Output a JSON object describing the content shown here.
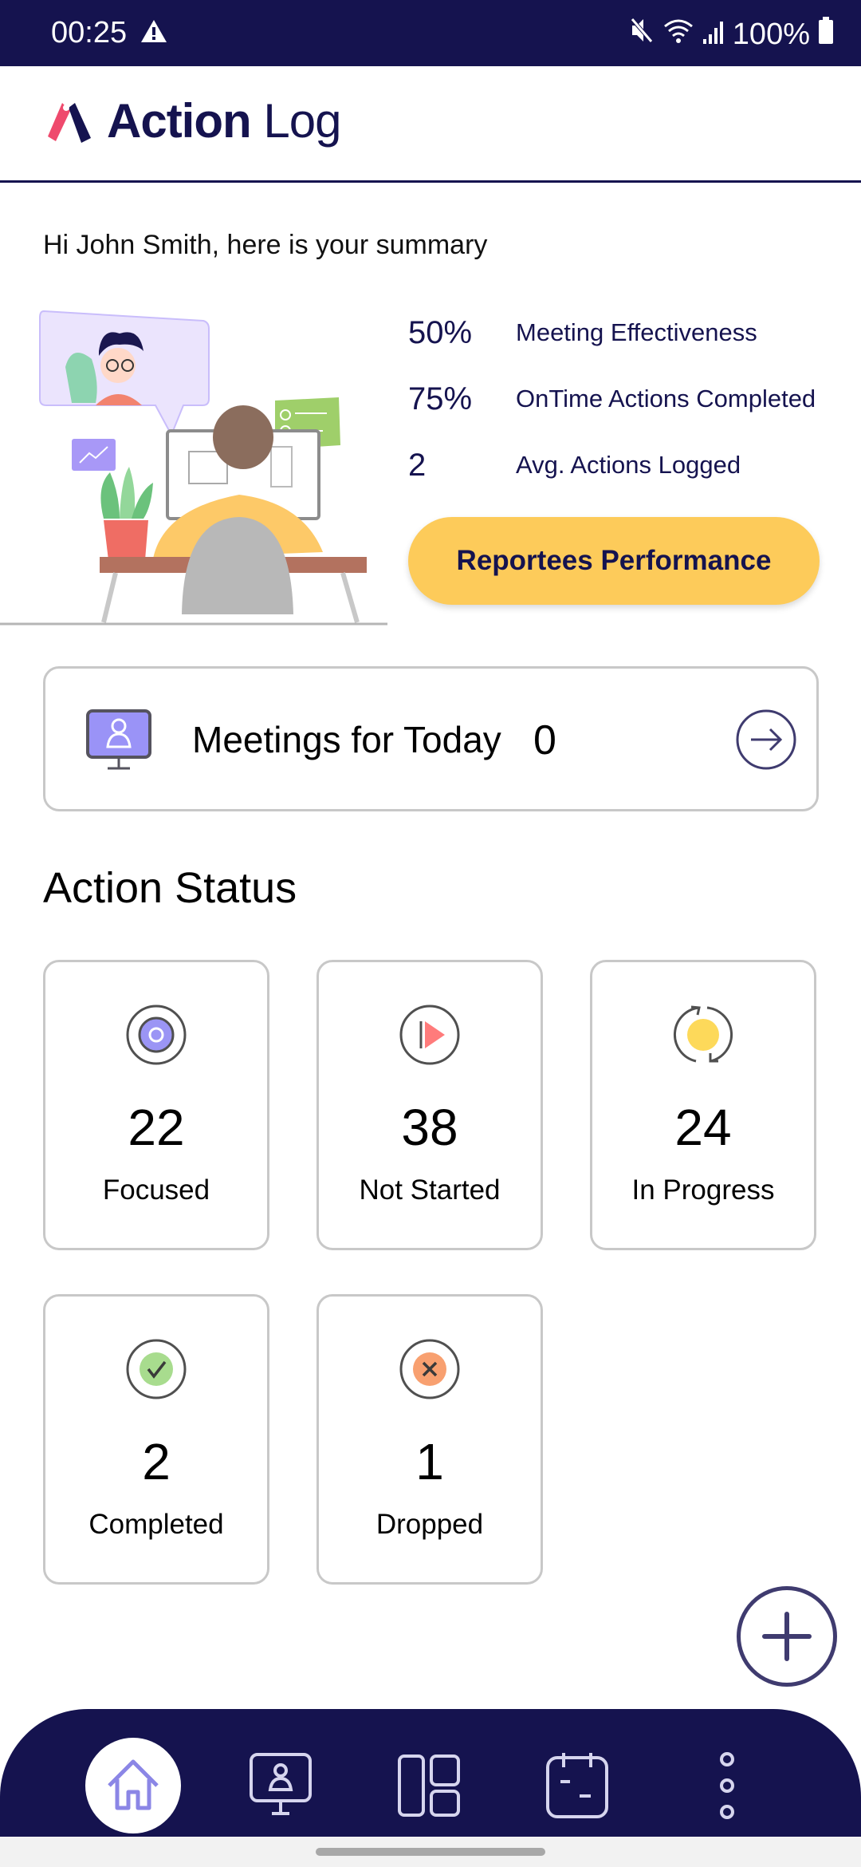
{
  "status_bar": {
    "time": "00:25",
    "battery": "100%",
    "icons": [
      "warning-icon",
      "mute-icon",
      "wifi-icon",
      "signal-icon",
      "battery-icon"
    ]
  },
  "header": {
    "brand_bold": "Action",
    "brand_light": "Log"
  },
  "greeting": "Hi John Smith, here is your summary",
  "summary": {
    "stats": [
      {
        "value": "50%",
        "label": "Meeting Effectiveness"
      },
      {
        "value": "75%",
        "label": "OnTime Actions Completed"
      },
      {
        "value": "2",
        "label": "Avg. Actions Logged"
      }
    ],
    "button_label": "Reportees Performance"
  },
  "meetings": {
    "label": "Meetings for Today",
    "count": "0"
  },
  "action_status": {
    "title": "Action Status",
    "cards": [
      {
        "count": "22",
        "label": "Focused",
        "icon": "target-icon",
        "color": "#9b95f5"
      },
      {
        "count": "38",
        "label": "Not Started",
        "icon": "play-icon",
        "color": "#ff7b7b"
      },
      {
        "count": "24",
        "label": "In Progress",
        "icon": "refresh-icon",
        "color": "#fdd95a"
      },
      {
        "count": "2",
        "label": "Completed",
        "icon": "check-icon",
        "color": "#a8dc8e"
      },
      {
        "count": "1",
        "label": "Dropped",
        "icon": "cross-icon",
        "color": "#f8a070"
      }
    ]
  },
  "bottom_nav": {
    "items": [
      {
        "name": "home",
        "icon": "home-icon",
        "active": true
      },
      {
        "name": "meetings",
        "icon": "meeting-icon",
        "active": false
      },
      {
        "name": "dashboard",
        "icon": "dashboard-icon",
        "active": false
      },
      {
        "name": "calendar",
        "icon": "calendar-icon",
        "active": false
      },
      {
        "name": "more",
        "icon": "more-vertical-icon",
        "active": false
      }
    ]
  },
  "colors": {
    "primary": "#15134f",
    "accent": "#fdcb5a",
    "brand_pink": "#ef4a6d"
  }
}
